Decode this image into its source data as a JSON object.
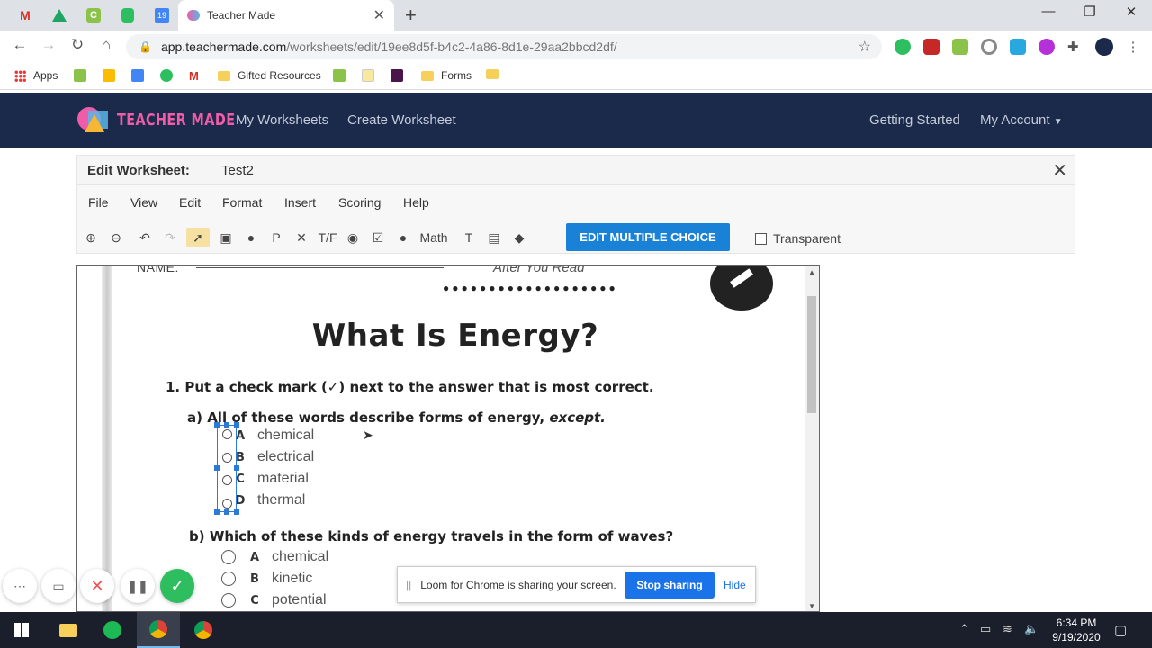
{
  "browser": {
    "tab_title": "Teacher Made",
    "url_host": "app.teachermade.com",
    "url_path": "/worksheets/edit/19ee8d5f-b4c2-4a86-8d1e-29aa2bbcd2df/",
    "bookmarks": {
      "apps": "Apps",
      "gifted": "Gifted Resources",
      "forms": "Forms"
    }
  },
  "site": {
    "logo_text": "TEACHER MADE",
    "nav": {
      "my_worksheets": "My Worksheets",
      "create_worksheet": "Create Worksheet",
      "getting_started": "Getting Started",
      "my_account": "My Account"
    }
  },
  "editor": {
    "label": "Edit Worksheet:",
    "name": "Test2",
    "menu": [
      "File",
      "View",
      "Edit",
      "Format",
      "Insert",
      "Scoring",
      "Help"
    ],
    "tools": {
      "p": "P",
      "tf": "T/F",
      "math": "Math"
    },
    "edit_mc_label": "EDIT MULTIPLE CHOICE",
    "transparent_label": "Transparent"
  },
  "worksheet": {
    "name_label": "NAME:",
    "top_right": "After You Read",
    "title": "What Is Energy?",
    "q1": "1.  Put a check mark (✓) next to the answer that is most correct.",
    "qa_prefix": "a)  All of these words describe forms of energy,",
    "qa_emph": "except.",
    "qa_options": [
      {
        "letter": "A",
        "text": "chemical"
      },
      {
        "letter": "B",
        "text": "electrical"
      },
      {
        "letter": "C",
        "text": "material"
      },
      {
        "letter": "D",
        "text": "thermal"
      }
    ],
    "qb": "b)  Which of these kinds of energy travels in the form of waves?",
    "qb_options": [
      {
        "letter": "A",
        "text": "chemical"
      },
      {
        "letter": "B",
        "text": "kinetic"
      },
      {
        "letter": "C",
        "text": "potential"
      }
    ]
  },
  "loom": {
    "message": "Loom for Chrome is sharing your screen.",
    "stop": "Stop sharing",
    "hide": "Hide"
  },
  "taskbar": {
    "time": "6:34 PM",
    "date": "9/19/2020"
  }
}
